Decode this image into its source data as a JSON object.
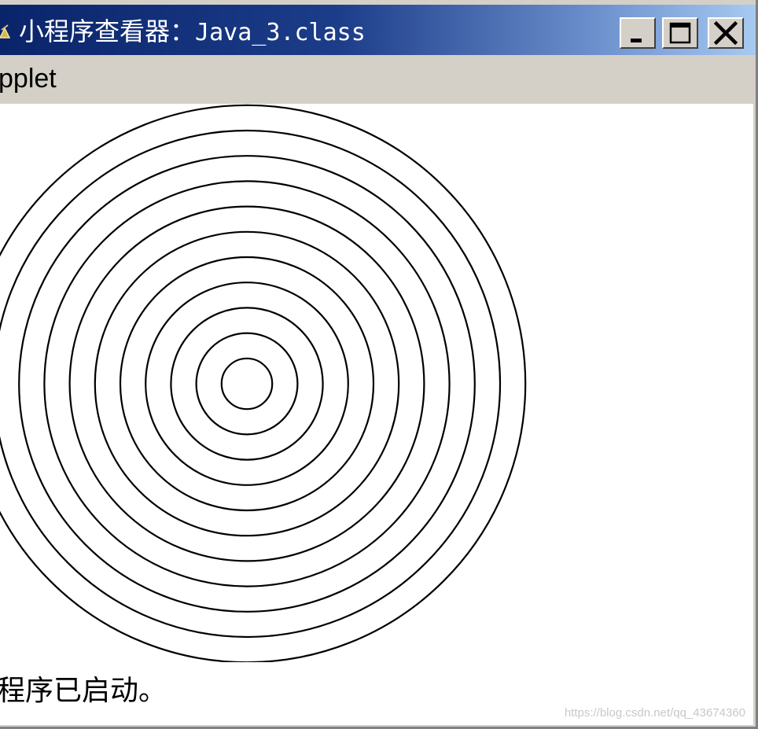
{
  "window": {
    "title": "小程序查看器：",
    "title_file": "Java_3.class",
    "title_gradient_start": "#0a246a",
    "title_gradient_end": "#a6caf0"
  },
  "titlebar_buttons": [
    {
      "name": "minimize-button",
      "icon": "minimize-icon"
    },
    {
      "name": "maximize-button",
      "icon": "maximize-icon"
    },
    {
      "name": "close-button",
      "icon": "close-icon"
    }
  ],
  "menu": {
    "applet_label": "pplet"
  },
  "drawing": {
    "shape": "concentric-circles",
    "ring_count": 11,
    "stroke_color": "#000000"
  },
  "status": {
    "text": "程序已启动。"
  },
  "watermark": {
    "text": "https://blog.csdn.net/qq_43674360"
  }
}
